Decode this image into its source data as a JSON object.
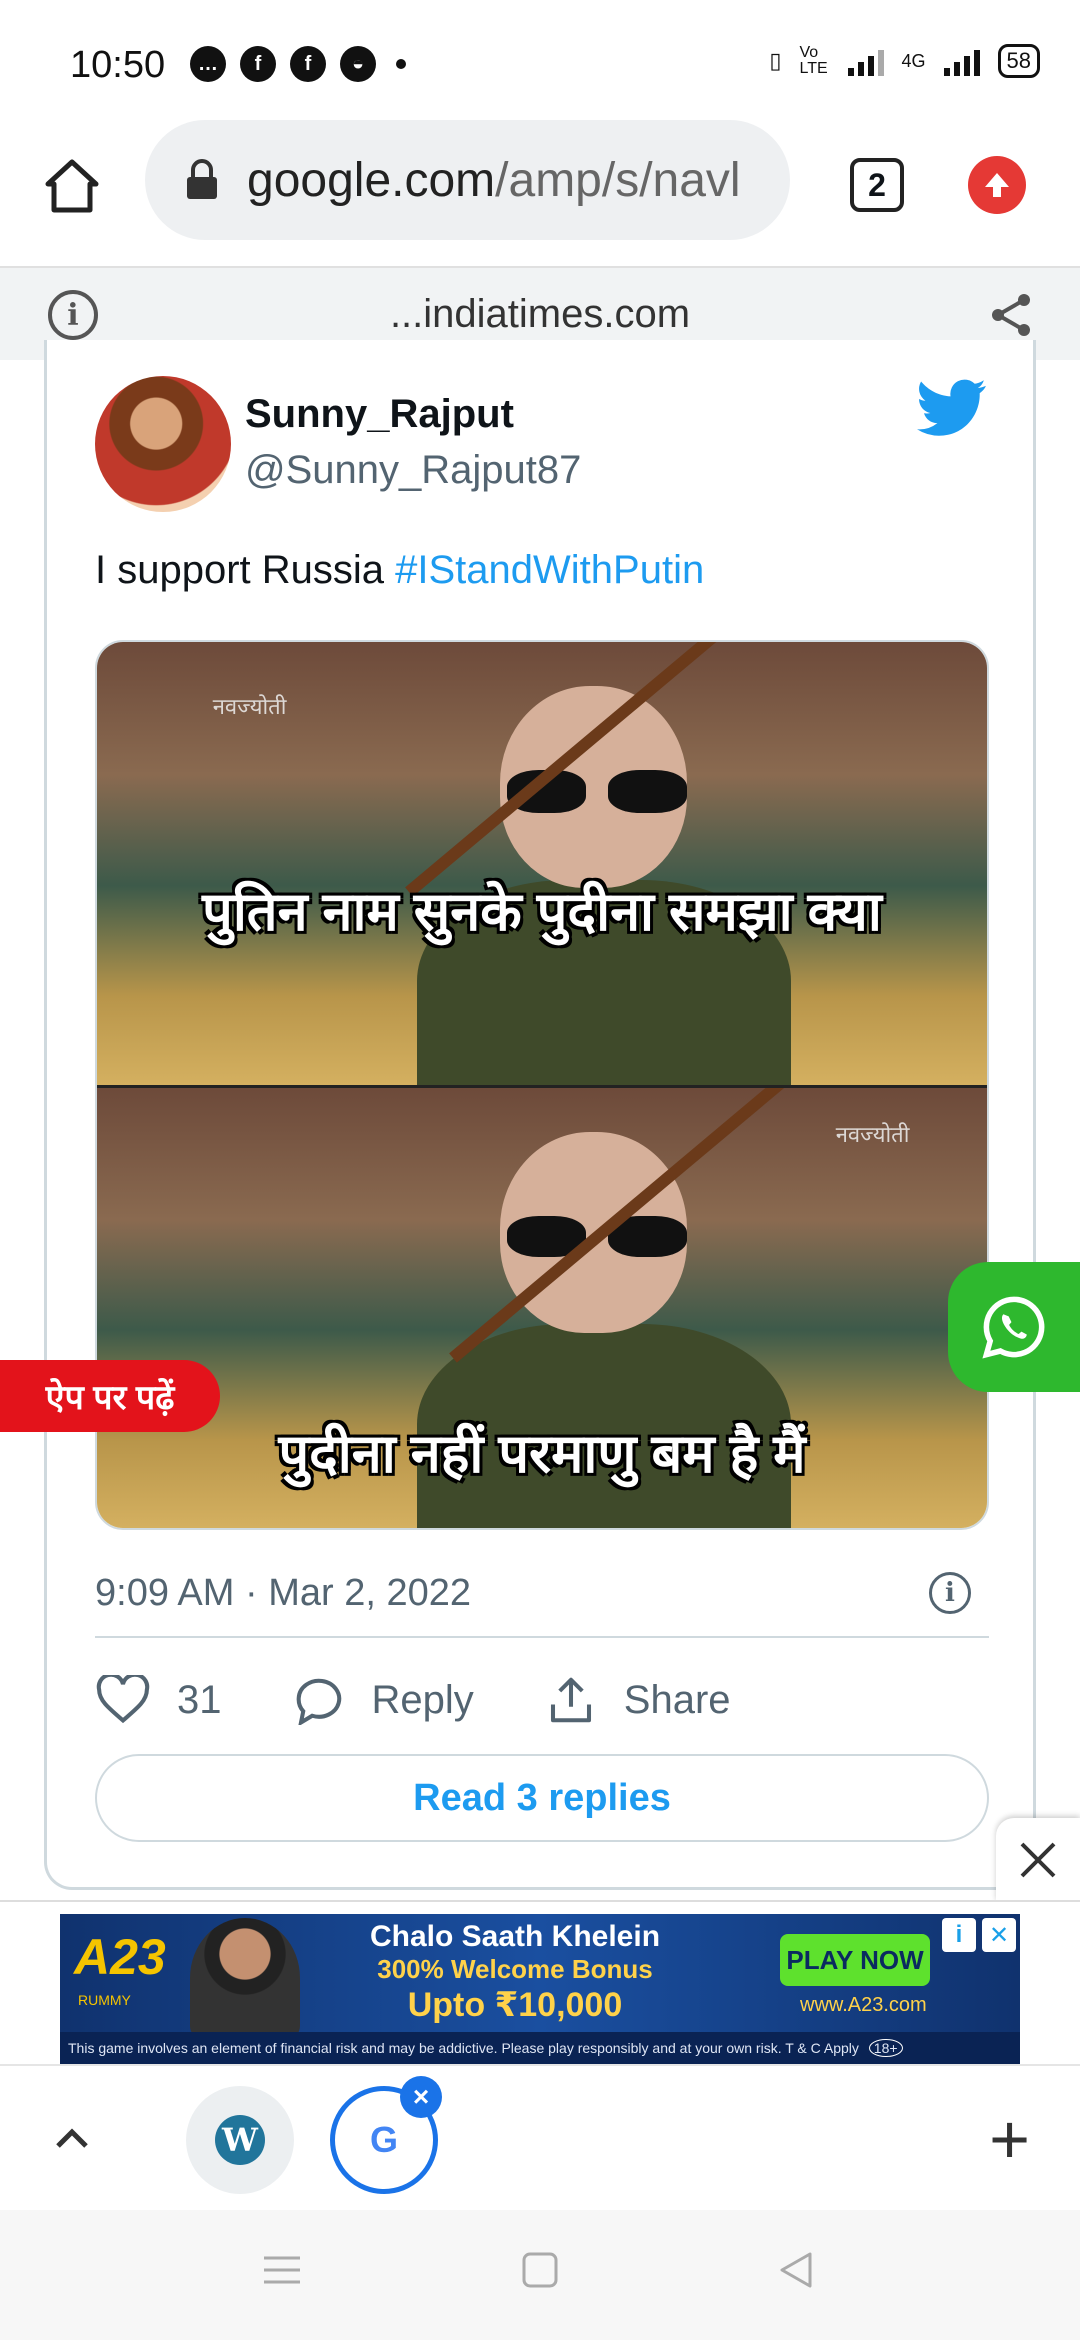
{
  "status_bar": {
    "time": "10:50",
    "battery": "58",
    "network": "4G",
    "volte": "Vo LTE",
    "notification_icons": [
      "chat-bubble-icon",
      "facebook-icon",
      "facebook-icon",
      "android-head-icon"
    ]
  },
  "browser": {
    "url_host": "google.com",
    "url_path": "/amp/s/navl",
    "tab_count": "2",
    "site_domain": "...indiatimes.com"
  },
  "tweet": {
    "display_name": "Sunny_Rajput",
    "handle": "@Sunny_Rajput87",
    "text": "I support Russia ",
    "hashtag": "#IStandWithPutin",
    "media": {
      "caption_top": "पुतिन नाम सुनके पुदीना समझा क्या",
      "caption_bottom": "पुदीना नहीं परमाणु बम है मैं",
      "watermark": "नवज्योती"
    },
    "timestamp": "9:09 AM · Mar 2, 2022",
    "likes": "31",
    "reply_label": "Reply",
    "share_label": "Share",
    "read_replies_label": "Read 3 replies"
  },
  "floating": {
    "app_read_label": "ऐप पर पढ़ें"
  },
  "ad": {
    "logo": "A23",
    "logo_sub": "RUMMY",
    "headline_1": "Chalo Saath Khelein",
    "headline_2": "300% Welcome Bonus",
    "headline_3": "Upto ₹10,000",
    "cta": "PLAY NOW",
    "url": "www.A23.com",
    "disclaimer": "This game involves an element of financial risk and may be addictive. Please play responsibly and at your own risk.   T & C Apply",
    "age_badge": "18+"
  },
  "colors": {
    "twitter_blue": "#1d9bf0",
    "whatsapp_green": "#2eb82e",
    "app_red": "#e3131b"
  }
}
